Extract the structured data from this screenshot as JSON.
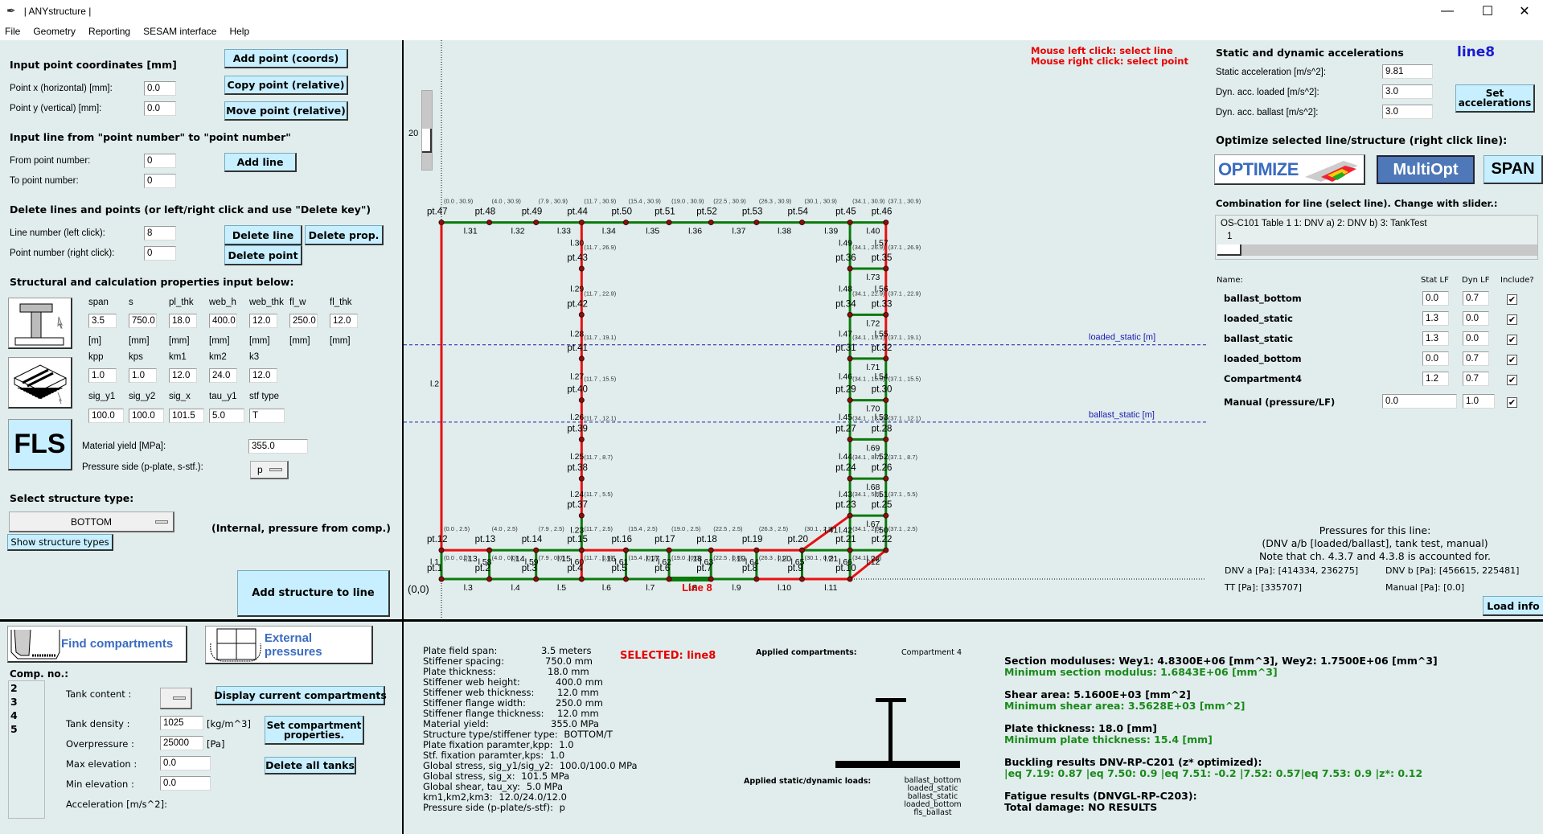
{
  "window": {
    "title": "| ANYstructure |",
    "feather_icon": "feather-icon",
    "controls": [
      "—",
      "☐",
      "✕"
    ]
  },
  "menu": [
    "File",
    "Geometry",
    "Reporting",
    "SESAM interface",
    "Help"
  ],
  "left": {
    "point_section": {
      "header": "Input point coordinates [mm]",
      "x_label": "Point x (horizontal) [mm]:",
      "x_value": "0.0",
      "y_label": "Point y (vertical)   [mm]:",
      "y_value": "0.0",
      "add_point": "Add point (coords)",
      "copy_point": "Copy point (relative)",
      "move_point": "Move point (relative)"
    },
    "line_section": {
      "header": "Input line from \"point number\" to \"point number\"",
      "from_label": "From point number:",
      "from_value": "0",
      "to_label": "To point number:",
      "to_value": "0",
      "add_line": "Add line"
    },
    "delete_section": {
      "header": "Delete lines and points (or left/right click and use \"Delete key\")",
      "line_label": "Line number (left click):",
      "line_value": "8",
      "point_label": "Point number (right click):",
      "point_value": "0",
      "delete_line": "Delete line",
      "delete_prop": "Delete prop.",
      "delete_point": "Delete point"
    },
    "props_section": {
      "header": "Structural and calculation properties input below:",
      "row1_labels": [
        "span",
        "s",
        "pl_thk",
        "web_h",
        "web_thk",
        "fl_w",
        "fl_thk"
      ],
      "row1_values": [
        "3.5",
        "750.0",
        "18.0",
        "400.0",
        "12.0",
        "250.0",
        "12.0"
      ],
      "row1_units": [
        "[m]",
        "[mm]",
        "[mm]",
        "[mm]",
        "[mm]",
        "[mm]",
        "[mm]"
      ],
      "row2_labels": [
        "kpp",
        "kps",
        "km1",
        "km2",
        "k3"
      ],
      "row2_values": [
        "1.0",
        "1.0",
        "12.0",
        "24.0",
        "12.0"
      ],
      "row3_labels": [
        "sig_y1",
        "sig_y2",
        "sig_x",
        "tau_y1",
        "stf type"
      ],
      "row3_values": [
        "100.0",
        "100.0",
        "101.5",
        "5.0",
        "T"
      ],
      "fls_label": "FLS",
      "yield_label": "Material yield [MPa]:",
      "yield_value": "355.0",
      "pressure_side_label": "Pressure side (p-plate, s-stf.):",
      "pressure_side_value": "p"
    },
    "structure_type": {
      "header": "Select structure type:",
      "value": "BOTTOM",
      "note": "(Internal, pressure from comp.)",
      "show_types": "Show structure types",
      "add_structure": "Add structure to line"
    }
  },
  "canvas": {
    "zoom_value": "20",
    "hint_left": "Mouse left click:  select line",
    "hint_right": "Mouse right click: select point",
    "origin_label": "(0,0)",
    "selected_line_label": "Line 8",
    "loaded_static_label": "loaded_static [m]",
    "ballast_static_label": "ballast_static [m]",
    "points": [
      {
        "n": "pt.47",
        "x": 0.0,
        "y": 30.9
      },
      {
        "n": "pt.48",
        "x": 4.0,
        "y": 30.9
      },
      {
        "n": "pt.49",
        "x": 7.9,
        "y": 30.9
      },
      {
        "n": "pt.44",
        "x": 11.7,
        "y": 30.9
      },
      {
        "n": "pt.50",
        "x": 15.4,
        "y": 30.9
      },
      {
        "n": "pt.51",
        "x": 19.0,
        "y": 30.9
      },
      {
        "n": "pt.52",
        "x": 22.5,
        "y": 30.9
      },
      {
        "n": "pt.53",
        "x": 26.3,
        "y": 30.9
      },
      {
        "n": "pt.54",
        "x": 30.1,
        "y": 30.9
      },
      {
        "n": "pt.45",
        "x": 34.1,
        "y": 30.9
      },
      {
        "n": "pt.46",
        "x": 37.1,
        "y": 30.9
      },
      {
        "n": "pt.43",
        "x": 11.7,
        "y": 26.9
      },
      {
        "n": "pt.42",
        "x": 11.7,
        "y": 22.9
      },
      {
        "n": "pt.41",
        "x": 11.7,
        "y": 19.1
      },
      {
        "n": "pt.40",
        "x": 11.7,
        "y": 15.5
      },
      {
        "n": "pt.39",
        "x": 11.7,
        "y": 12.1
      },
      {
        "n": "pt.38",
        "x": 11.7,
        "y": 8.7
      },
      {
        "n": "pt.37",
        "x": 11.7,
        "y": 5.5
      },
      {
        "n": "pt.36",
        "x": 34.1,
        "y": 26.9
      },
      {
        "n": "pt.35",
        "x": 37.1,
        "y": 26.9
      },
      {
        "n": "pt.34",
        "x": 34.1,
        "y": 22.9
      },
      {
        "n": "pt.33",
        "x": 37.1,
        "y": 22.9
      },
      {
        "n": "pt.31",
        "x": 34.1,
        "y": 19.1
      },
      {
        "n": "pt.32",
        "x": 37.1,
        "y": 19.1
      },
      {
        "n": "pt.29",
        "x": 34.1,
        "y": 15.5
      },
      {
        "n": "pt.30",
        "x": 37.1,
        "y": 15.5
      },
      {
        "n": "pt.27",
        "x": 34.1,
        "y": 12.1
      },
      {
        "n": "pt.28",
        "x": 37.1,
        "y": 12.1
      },
      {
        "n": "pt.24",
        "x": 34.1,
        "y": 8.7
      },
      {
        "n": "pt.26",
        "x": 37.1,
        "y": 8.7
      },
      {
        "n": "pt.23",
        "x": 34.1,
        "y": 5.5
      },
      {
        "n": "pt.25",
        "x": 37.1,
        "y": 5.5
      },
      {
        "n": "pt.12",
        "x": 0.0,
        "y": 2.5
      },
      {
        "n": "pt.13",
        "x": 4.0,
        "y": 2.5
      },
      {
        "n": "pt.14",
        "x": 7.9,
        "y": 2.5
      },
      {
        "n": "pt.15",
        "x": 11.7,
        "y": 2.5
      },
      {
        "n": "pt.16",
        "x": 15.4,
        "y": 2.5
      },
      {
        "n": "pt.17",
        "x": 19.0,
        "y": 2.5
      },
      {
        "n": "pt.18",
        "x": 22.5,
        "y": 2.5
      },
      {
        "n": "pt.19",
        "x": 26.3,
        "y": 2.5
      },
      {
        "n": "pt.20",
        "x": 30.1,
        "y": 2.5
      },
      {
        "n": "pt.21",
        "x": 34.1,
        "y": 2.5
      },
      {
        "n": "pt.22",
        "x": 37.1,
        "y": 2.5
      },
      {
        "n": "pt.1",
        "x": 0.0,
        "y": 0.0
      },
      {
        "n": "pt.2",
        "x": 4.0,
        "y": 0.0
      },
      {
        "n": "pt.3",
        "x": 7.9,
        "y": 0.0
      },
      {
        "n": "pt.4",
        "x": 11.7,
        "y": 0.0
      },
      {
        "n": "pt.5",
        "x": 15.4,
        "y": 0.0
      },
      {
        "n": "pt.6",
        "x": 19.0,
        "y": 0.0
      },
      {
        "n": "pt.7",
        "x": 22.5,
        "y": 0.0
      },
      {
        "n": "pt.8",
        "x": 26.3,
        "y": 0.0
      },
      {
        "n": "pt.9",
        "x": 30.1,
        "y": 0.0
      },
      {
        "n": "pt.10",
        "x": 34.1,
        "y": 0.0
      }
    ],
    "lines": [
      {
        "n": "l.31",
        "a": "pt.47",
        "b": "pt.48",
        "c": "green"
      },
      {
        "n": "l.32",
        "a": "pt.48",
        "b": "pt.49",
        "c": "green"
      },
      {
        "n": "l.33",
        "a": "pt.49",
        "b": "pt.44",
        "c": "green"
      },
      {
        "n": "l.34",
        "a": "pt.44",
        "b": "pt.50",
        "c": "green"
      },
      {
        "n": "l.35",
        "a": "pt.50",
        "b": "pt.51",
        "c": "green"
      },
      {
        "n": "l.36",
        "a": "pt.51",
        "b": "pt.52",
        "c": "green"
      },
      {
        "n": "l.37",
        "a": "pt.52",
        "b": "pt.53",
        "c": "green"
      },
      {
        "n": "l.38",
        "a": "pt.53",
        "b": "pt.54",
        "c": "green"
      },
      {
        "n": "l.39",
        "a": "pt.54",
        "b": "pt.45",
        "c": "green"
      },
      {
        "n": "l.40",
        "a": "pt.45",
        "b": "pt.46",
        "c": "green"
      },
      {
        "n": "l.2",
        "a": "pt.12",
        "b": "pt.47",
        "c": "red"
      },
      {
        "n": "l.30",
        "a": "pt.43",
        "b": "pt.44",
        "c": "red"
      },
      {
        "n": "l.29",
        "a": "pt.42",
        "b": "pt.43",
        "c": "red"
      },
      {
        "n": "l.28",
        "a": "pt.41",
        "b": "pt.42",
        "c": "red"
      },
      {
        "n": "l.27",
        "a": "pt.40",
        "b": "pt.41",
        "c": "red"
      },
      {
        "n": "l.26",
        "a": "pt.39",
        "b": "pt.40",
        "c": "red"
      },
      {
        "n": "l.25",
        "a": "pt.38",
        "b": "pt.39",
        "c": "red"
      },
      {
        "n": "l.24",
        "a": "pt.37",
        "b": "pt.38",
        "c": "red"
      },
      {
        "n": "l.23",
        "a": "pt.15",
        "b": "pt.37",
        "c": "green"
      },
      {
        "n": "l.49",
        "a": "pt.45",
        "b": "pt.36",
        "c": "green"
      },
      {
        "n": "l.48",
        "a": "pt.36",
        "b": "pt.34",
        "c": "green"
      },
      {
        "n": "l.47",
        "a": "pt.34",
        "b": "pt.31",
        "c": "green"
      },
      {
        "n": "l.46",
        "a": "pt.31",
        "b": "pt.29",
        "c": "green"
      },
      {
        "n": "l.45",
        "a": "pt.29",
        "b": "pt.27",
        "c": "green"
      },
      {
        "n": "l.44",
        "a": "pt.27",
        "b": "pt.24",
        "c": "green"
      },
      {
        "n": "l.43",
        "a": "pt.24",
        "b": "pt.23",
        "c": "green"
      },
      {
        "n": "l.42",
        "a": "pt.23",
        "b": "pt.21",
        "c": "green"
      },
      {
        "n": "l.57",
        "a": "pt.46",
        "b": "pt.35",
        "c": "red"
      },
      {
        "n": "l.56",
        "a": "pt.35",
        "b": "pt.33",
        "c": "red"
      },
      {
        "n": "l.55",
        "a": "pt.33",
        "b": "pt.32",
        "c": "red"
      },
      {
        "n": "l.54",
        "a": "pt.32",
        "b": "pt.30",
        "c": "green"
      },
      {
        "n": "l.53",
        "a": "pt.30",
        "b": "pt.28",
        "c": "green"
      },
      {
        "n": "l.52",
        "a": "pt.28",
        "b": "pt.26",
        "c": "green"
      },
      {
        "n": "l.51",
        "a": "pt.26",
        "b": "pt.25",
        "c": "green"
      },
      {
        "n": "l.50",
        "a": "pt.25",
        "b": "pt.22",
        "c": "green"
      },
      {
        "n": "l.73",
        "a": "pt.36",
        "b": "pt.35",
        "c": "green"
      },
      {
        "n": "l.72",
        "a": "pt.34",
        "b": "pt.33",
        "c": "green"
      },
      {
        "n": "l.71",
        "a": "pt.31",
        "b": "pt.32",
        "c": "green"
      },
      {
        "n": "l.70",
        "a": "pt.29",
        "b": "pt.30",
        "c": "green"
      },
      {
        "n": "l.69",
        "a": "pt.27",
        "b": "pt.28",
        "c": "green"
      },
      {
        "n": "l.68",
        "a": "pt.24",
        "b": "pt.26",
        "c": "green"
      },
      {
        "n": "l.67",
        "a": "pt.23",
        "b": "pt.25",
        "c": "green"
      },
      {
        "n": "l.41",
        "a": "pt.20",
        "b": "pt.23",
        "c": "red"
      },
      {
        "n": "l.13",
        "a": "pt.12",
        "b": "pt.13",
        "c": "red"
      },
      {
        "n": "l.14",
        "a": "pt.13",
        "b": "pt.14",
        "c": "green"
      },
      {
        "n": "l.15",
        "a": "pt.14",
        "b": "pt.15",
        "c": "green"
      },
      {
        "n": "l.16",
        "a": "pt.15",
        "b": "pt.16",
        "c": "red"
      },
      {
        "n": "l.17",
        "a": "pt.16",
        "b": "pt.17",
        "c": "green"
      },
      {
        "n": "l.18",
        "a": "pt.17",
        "b": "pt.18",
        "c": "green"
      },
      {
        "n": "l.19",
        "a": "pt.18",
        "b": "pt.19",
        "c": "red"
      },
      {
        "n": "l.20",
        "a": "pt.19",
        "b": "pt.20",
        "c": "red"
      },
      {
        "n": "l.21",
        "a": "pt.20",
        "b": "pt.21",
        "c": "green"
      },
      {
        "n": "l.22",
        "a": "pt.21",
        "b": "pt.22",
        "c": "green"
      },
      {
        "n": "l.1",
        "a": "pt.1",
        "b": "pt.12",
        "c": "green"
      },
      {
        "n": "l.58",
        "a": "pt.2",
        "b": "pt.13",
        "c": "green"
      },
      {
        "n": "l.59",
        "a": "pt.3",
        "b": "pt.14",
        "c": "green"
      },
      {
        "n": "l.60",
        "a": "pt.4",
        "b": "pt.15",
        "c": "red"
      },
      {
        "n": "l.61",
        "a": "pt.5",
        "b": "pt.16",
        "c": "green"
      },
      {
        "n": "l.62",
        "a": "pt.6",
        "b": "pt.17",
        "c": "green"
      },
      {
        "n": "l.63",
        "a": "pt.7",
        "b": "pt.18",
        "c": "green"
      },
      {
        "n": "l.64",
        "a": "pt.8",
        "b": "pt.19",
        "c": "green"
      },
      {
        "n": "l.65",
        "a": "pt.9",
        "b": "pt.20",
        "c": "green"
      },
      {
        "n": "l.66",
        "a": "pt.10",
        "b": "pt.21",
        "c": "green"
      },
      {
        "n": "l.12",
        "a": "pt.10",
        "b": "pt.22",
        "c": "red"
      },
      {
        "n": "l.3",
        "a": "pt.1",
        "b": "pt.2",
        "c": "green"
      },
      {
        "n": "l.4",
        "a": "pt.2",
        "b": "pt.3",
        "c": "green"
      },
      {
        "n": "l.5",
        "a": "pt.3",
        "b": "pt.4",
        "c": "green"
      },
      {
        "n": "l.6",
        "a": "pt.4",
        "b": "pt.5",
        "c": "green"
      },
      {
        "n": "l.7",
        "a": "pt.5",
        "b": "pt.6",
        "c": "green"
      },
      {
        "n": "l.8",
        "a": "pt.6",
        "b": "pt.7",
        "c": "green",
        "selected": true
      },
      {
        "n": "l.9",
        "a": "pt.7",
        "b": "pt.8",
        "c": "green"
      },
      {
        "n": "l.10",
        "a": "pt.8",
        "b": "pt.9",
        "c": "red"
      },
      {
        "n": "l.11",
        "a": "pt.9",
        "b": "pt.10",
        "c": "red"
      }
    ],
    "loaded_static_level_m": 20.3,
    "ballast_static_level_m": 13.6
  },
  "right": {
    "acc_header": "Static and dynamic accelerations",
    "selected_line": "line8",
    "static_label": "Static acceleration [m/s^2]:",
    "static_value": "9.81",
    "dyn_loaded_label": "Dyn. acc. loaded [m/s^2]:",
    "dyn_loaded_value": "3.0",
    "dyn_ballast_label": "Dyn. acc. ballast [m/s^2]:",
    "dyn_ballast_value": "3.0",
    "set_acc": "Set accelerations",
    "optimize_header": "Optimize selected line/structure (right click line):",
    "optimize": "OPTIMIZE",
    "multiopt": "MultiOpt",
    "span": "SPAN",
    "combo_header": "Combination for line (select line). Change with slider.:",
    "combo_text": "OS-C101 Table 1    1: DNV a)    2: DNV b)    3: TankTest",
    "combo_value": "1",
    "table_headers": {
      "name": "Name:",
      "stat": "Stat LF",
      "dyn": "Dyn LF",
      "include": "Include?"
    },
    "loads": [
      {
        "name": "ballast_bottom",
        "stat": "0.0",
        "dyn": "0.7",
        "include": true
      },
      {
        "name": "loaded_static",
        "stat": "1.3",
        "dyn": "0.0",
        "include": true
      },
      {
        "name": "ballast_static",
        "stat": "1.3",
        "dyn": "0.0",
        "include": true
      },
      {
        "name": "loaded_bottom",
        "stat": "0.0",
        "dyn": "0.7",
        "include": true
      },
      {
        "name": "Compartment4",
        "stat": "1.2",
        "dyn": "0.7",
        "include": true
      }
    ],
    "manual": {
      "name": "Manual (pressure/LF)",
      "pressure": "0.0",
      "lf": "1.0",
      "include": true
    },
    "pressures_title": "Pressures for this line:",
    "pressures_sub": "(DNV a/b [loaded/ballast], tank test, manual)",
    "pressures_note": "Note that ch. 4.3.7 and 4.3.8 is accounted for.",
    "dnv_a": "DNV a [Pa]: [414334, 236275]",
    "dnv_b": "DNV b [Pa]: [456615, 225481]",
    "tt": "TT [Pa]: [335707]",
    "manual_pa": "Manual [Pa]: [0.0]",
    "load_info": "Load info"
  },
  "bottom_left": {
    "find_comp": "Find compartments",
    "ext_press": "External pressures",
    "comp_header": "Comp. no.:",
    "comps": [
      "2",
      "3",
      "4",
      "5"
    ],
    "tank_content_label": "Tank content :",
    "tank_density_label": "Tank density :",
    "tank_density_value": "1025",
    "tank_density_unit": "[kg/m^3]",
    "overpressure_label": "Overpressure :",
    "overpressure_value": "25000",
    "overpressure_unit": "[Pa]",
    "max_elev_label": "Max elevation :",
    "max_elev_value": "0.0",
    "min_elev_label": "Min elevation :",
    "min_elev_value": "0.0",
    "accel_label": "Acceleration [m/s^2]:",
    "display_comp": "Display current compartments",
    "set_comp": "Set compartment properties.",
    "delete_tanks": "Delete all tanks"
  },
  "bottom_mid": {
    "props": [
      [
        "Plate field span:",
        "3.5 meters"
      ],
      [
        "Stiffener spacing:",
        "750.0 mm"
      ],
      [
        "Plate thickness:",
        "18.0 mm"
      ],
      [
        "Stiffener web height:",
        "400.0 mm"
      ],
      [
        "Stiffener web thickness:",
        "12.0 mm"
      ],
      [
        "Stiffener flange width:",
        "250.0 mm"
      ],
      [
        "Stiffener flange thickness:",
        "12.0 mm"
      ],
      [
        "Material yield:",
        "355.0 MPa"
      ],
      [
        "Structure type/stiffener type:",
        "BOTTOM/T"
      ],
      [
        "Plate fixation paramter,kpp:",
        "1.0"
      ],
      [
        "Stf. fixation paramter,kps:",
        "1.0"
      ],
      [
        "Global stress, sig_y1/sig_y2:",
        "100.0/100.0 MPa"
      ],
      [
        "Global stress, sig_x:",
        "101.5 MPa"
      ],
      [
        "Global shear, tau_xy:",
        "5.0 MPa"
      ],
      [
        "km1,km2,km3:",
        "12.0/24.0/12.0"
      ],
      [
        "Pressure side (p-plate/s-stf):",
        "p"
      ]
    ],
    "selected": "SELECTED: line8",
    "applied_comp_label": "Applied compartments:",
    "applied_comp_value": "Compartment 4",
    "applied_loads_label": "Applied static/dynamic loads:",
    "applied_loads": [
      "ballast_bottom",
      "loaded_static",
      "ballast_static",
      "loaded_bottom",
      "fls_ballast"
    ]
  },
  "results": {
    "section_mod": "Section moduluses: Wey1: 4.8300E+06 [mm^3],  Wey2: 1.7500E+06 [mm^3]",
    "min_section_mod": "Minimum section modulus: 1.6843E+06 [mm^3]",
    "shear_area": "Shear area: 5.1600E+03 [mm^2]",
    "min_shear_area": "Minimum shear area: 3.5628E+03 [mm^2]",
    "plate_thk": "Plate thickness: 18.0 [mm]",
    "min_plate_thk": "Minimum plate thickness: 15.4 [mm]",
    "buckling_header": "Buckling results DNV-RP-C201 (z* optimized):",
    "buckling_values": "|eq 7.19: 0.87 |eq 7.50: 0.9 |eq 7.51: -0.2 |7.52: 0.57|eq 7.53: 0.9 |z*: 0.12",
    "fatigue_header": "Fatigue results (DNVGL-RP-C203):",
    "fatigue_value": "Total damage: NO RESULTS"
  },
  "colors": {
    "ok_line": "#0a7a0a",
    "fail_line": "#e81010",
    "button": "#c7efff",
    "result_green": "#1a8a1a",
    "hint_red": "#e80000",
    "accent_blue": "#1a1ad0"
  }
}
